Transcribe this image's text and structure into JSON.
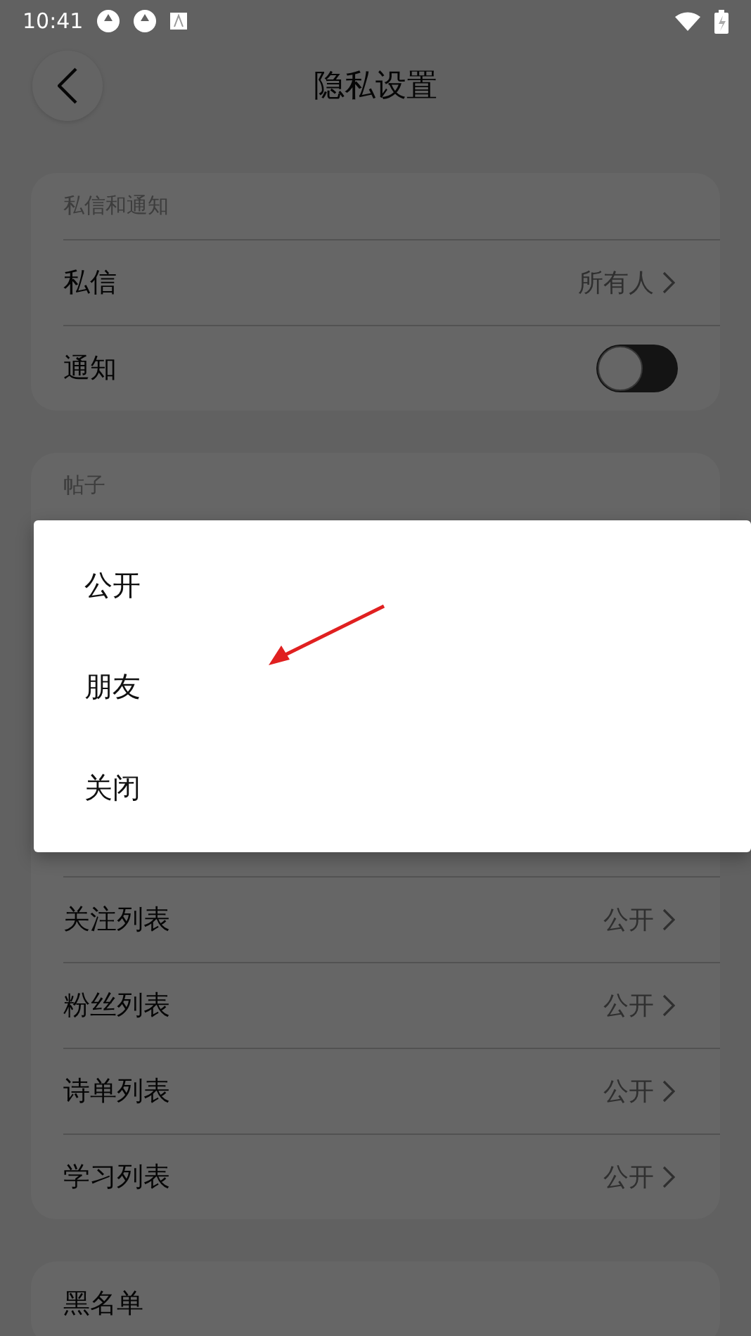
{
  "status_bar": {
    "time": "10:41"
  },
  "header": {
    "title": "隐私设置"
  },
  "sections": [
    {
      "title": "私信和通知",
      "rows": [
        {
          "kind": "link",
          "label": "私信",
          "value": "所有人"
        },
        {
          "kind": "toggle",
          "label": "通知",
          "on": false
        }
      ]
    },
    {
      "title": "帖子",
      "rows": [
        {
          "kind": "link",
          "label": "关注列表",
          "value": "公开"
        },
        {
          "kind": "link",
          "label": "粉丝列表",
          "value": "公开"
        },
        {
          "kind": "link",
          "label": "诗单列表",
          "value": "公开"
        },
        {
          "kind": "link",
          "label": "学习列表",
          "value": "公开"
        }
      ]
    },
    {
      "rows": [
        {
          "kind": "plain",
          "label": "黑名单"
        }
      ]
    }
  ],
  "dialog": {
    "options": [
      {
        "label": "公开"
      },
      {
        "label": "朋友"
      },
      {
        "label": "关闭"
      }
    ]
  }
}
